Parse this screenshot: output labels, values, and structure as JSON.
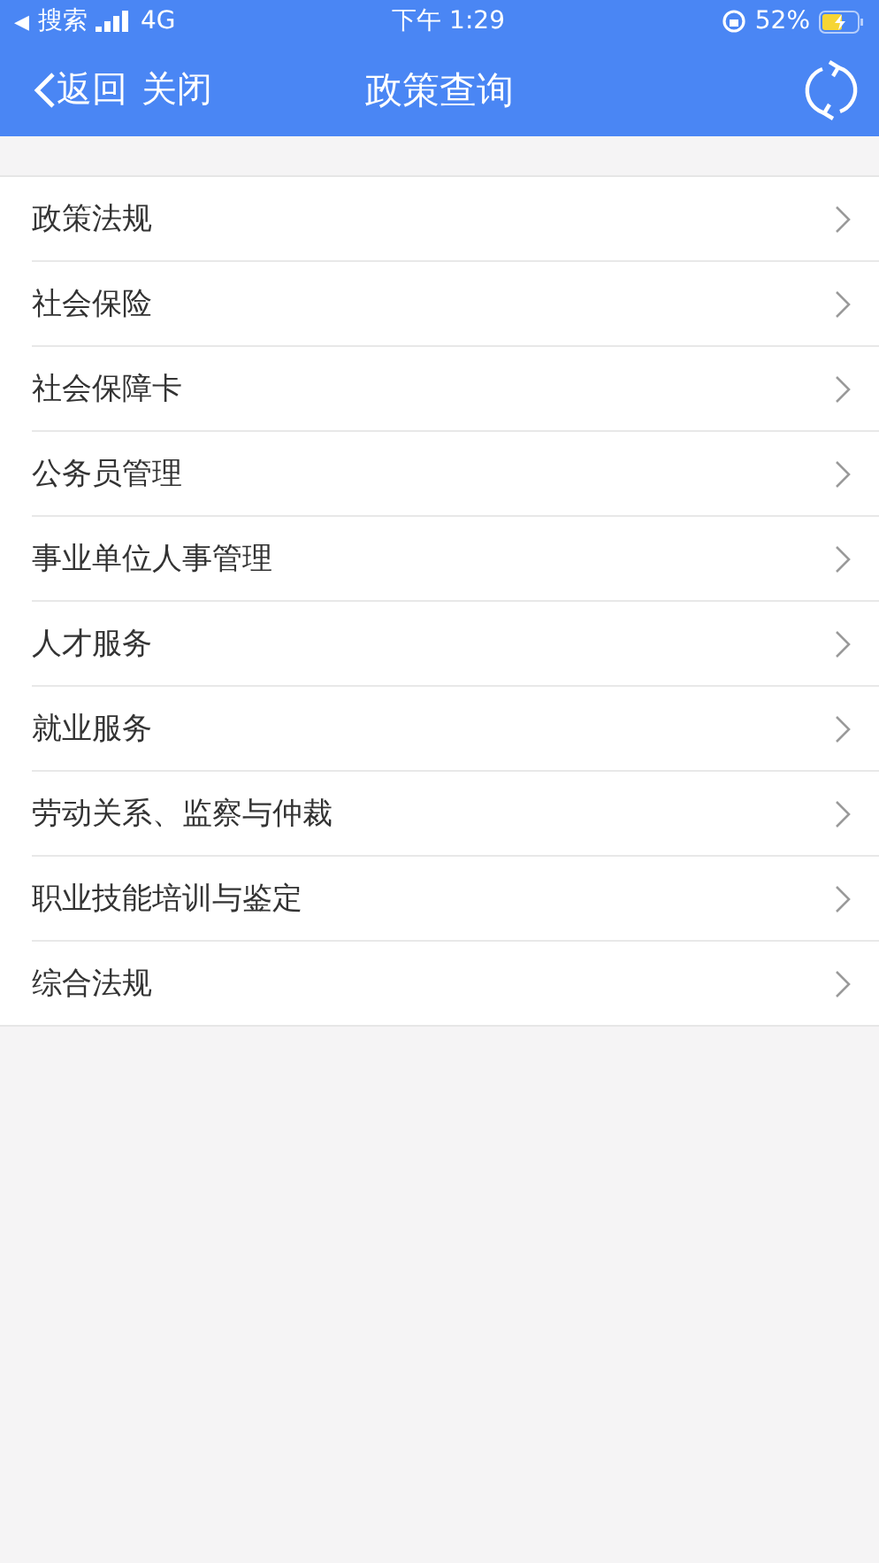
{
  "status_bar": {
    "back_arrow": "◀",
    "back_app": "搜索",
    "network": "4G",
    "time": "下午 1:29",
    "battery": "52%"
  },
  "nav_bar": {
    "back": "返回",
    "close": "关闭",
    "title": "政策查询"
  },
  "items": [
    {
      "label": "政策法规"
    },
    {
      "label": "社会保险"
    },
    {
      "label": "社会保障卡"
    },
    {
      "label": "公务员管理"
    },
    {
      "label": "事业单位人事管理"
    },
    {
      "label": "人才服务"
    },
    {
      "label": "就业服务"
    },
    {
      "label": "劳动关系、监察与仲裁"
    },
    {
      "label": "职业技能培训与鉴定"
    },
    {
      "label": "综合法规"
    }
  ]
}
